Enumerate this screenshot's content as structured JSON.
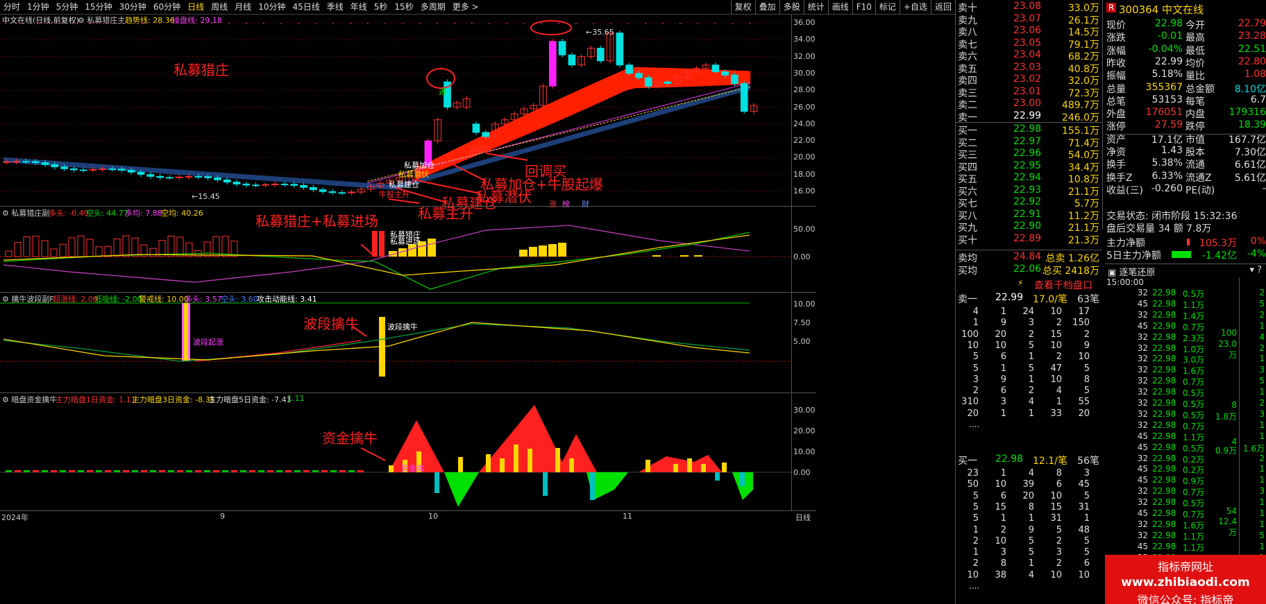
{
  "toolbar": {
    "tabs": [
      "分时",
      "1分钟",
      "5分钟",
      "15分钟",
      "30分钟",
      "60分钟",
      "日线",
      "周线",
      "月线",
      "10分钟",
      "45日线",
      "季线",
      "年线",
      "5秒",
      "15秒",
      "多周期",
      "更多 >"
    ],
    "active": "日线",
    "right": [
      "复权",
      "叠加",
      "多股",
      "统计",
      "画线",
      "F10",
      "标记",
      "+自选",
      "返回"
    ]
  },
  "main": {
    "title": "中文在线(日线,前复权)",
    "indicator": "私募猎庄主",
    "trend_label": "趋势线: 28.36",
    "control_label": "操盘线: 29.18",
    "y_ticks": [
      "36.00",
      "34.00",
      "32.00",
      "30.00",
      "28.00",
      "26.00",
      "24.00",
      "22.00",
      "20.00",
      "18.00",
      "16.00"
    ],
    "high_label": "35.65",
    "low_label": "15.45",
    "annotations": [
      "私募猎庄",
      "回调买",
      "私募加仓+牛股起爆",
      "私募潜伏",
      "私募建仓",
      "私募主升"
    ],
    "small_labels": [
      "私募加仓",
      "私募潜伏",
      "私募建仓",
      "牛股主升",
      "回调买",
      "进",
      "涨",
      "榜",
      "财"
    ]
  },
  "sub1": {
    "name": "私募猎庄副",
    "values": [
      "多头: -0.49",
      "空头: 44.77",
      "多均: 7.88",
      "空均: 40.26"
    ],
    "y_ticks": [
      "50.00",
      "0.00"
    ],
    "annotation": "私募猎庄+私募进场",
    "small": [
      "私募猎庄",
      "私募进场"
    ]
  },
  "sub2": {
    "name": "擒牛波段副F",
    "values": [
      "超涨线: 2.00",
      "低吸线: -2.00",
      "警戒线: 10.00",
      "多头: 3.57",
      "空头: 3.60",
      "攻击动能线: 3.41"
    ],
    "y_ticks": [
      "10.00",
      "7.50",
      "5.00"
    ],
    "annotation": "波段擒牛",
    "small": [
      "波段起涨",
      "波段擒牛"
    ]
  },
  "sub3": {
    "name": "暗盘资金擒牛",
    "values": [
      "主力暗盘1日资金: 1.11",
      "主力暗盘3日资金: -8.35",
      "主力暗盘5日资金: -7.41",
      "1.11"
    ],
    "y_ticks": [
      "30.00",
      "20.00",
      "10.00",
      "0.00"
    ],
    "annotation": "资金擒牛",
    "small": "资金擒"
  },
  "xaxis": {
    "labels": [
      "2024年",
      "9",
      "10",
      "11"
    ],
    "period": "日线"
  },
  "orderbook": {
    "asks": [
      {
        "label": "卖十",
        "price": "23.08",
        "vol": "33.0万"
      },
      {
        "label": "卖九",
        "price": "23.07",
        "vol": "26.1万"
      },
      {
        "label": "卖八",
        "price": "23.06",
        "vol": "14.5万"
      },
      {
        "label": "卖七",
        "price": "23.05",
        "vol": "79.1万"
      },
      {
        "label": "卖六",
        "price": "23.04",
        "vol": "68.2万"
      },
      {
        "label": "卖五",
        "price": "23.03",
        "vol": "40.8万"
      },
      {
        "label": "卖四",
        "price": "23.02",
        "vol": "32.0万"
      },
      {
        "label": "卖三",
        "price": "23.01",
        "vol": "72.3万"
      },
      {
        "label": "卖二",
        "price": "23.00",
        "vol": "489.7万"
      },
      {
        "label": "卖一",
        "price": "22.99",
        "vol": "246.0万"
      }
    ],
    "bids": [
      {
        "label": "买一",
        "price": "22.98",
        "vol": "155.1万"
      },
      {
        "label": "买二",
        "price": "22.97",
        "vol": "71.4万"
      },
      {
        "label": "买三",
        "price": "22.96",
        "vol": "54.0万"
      },
      {
        "label": "买四",
        "price": "22.95",
        "vol": "34.4万"
      },
      {
        "label": "买五",
        "price": "22.94",
        "vol": "10.8万"
      },
      {
        "label": "买六",
        "price": "22.93",
        "vol": "21.1万"
      },
      {
        "label": "买七",
        "price": "22.92",
        "vol": "5.7万"
      },
      {
        "label": "买八",
        "price": "22.91",
        "vol": "11.2万"
      },
      {
        "label": "买九",
        "price": "22.90",
        "vol": "21.1万"
      },
      {
        "label": "买十",
        "price": "22.89",
        "vol": "21.3万"
      }
    ],
    "sell_avg": {
      "label": "卖均",
      "price": "24.84",
      "tlabel": "总卖",
      "vol": "1.26亿"
    },
    "buy_avg": {
      "label": "买均",
      "price": "22.06",
      "tlabel": "总买",
      "vol": "2418万"
    },
    "ticket_btn": "查看千档盘口",
    "sell1_header": {
      "label": "卖一",
      "price": "22.99",
      "per": "17.0/笔",
      "count": "63笔"
    },
    "sell1_grid": [
      [
        "4",
        "1",
        "24",
        "10",
        "17"
      ],
      [
        "1",
        "9",
        "3",
        "2",
        "150"
      ],
      [
        "100",
        "20",
        "2",
        "15",
        "2"
      ],
      [
        "10",
        "10",
        "5",
        "10",
        "9"
      ],
      [
        "5",
        "6",
        "1",
        "2",
        "10"
      ],
      [
        "5",
        "1",
        "5",
        "47",
        "5"
      ],
      [
        "3",
        "9",
        "1",
        "10",
        "8"
      ],
      [
        "2",
        "6",
        "2",
        "4",
        "5"
      ],
      [
        "310",
        "3",
        "4",
        "1",
        "55"
      ],
      [
        "20",
        "1",
        "1",
        "33",
        "20"
      ]
    ],
    "buy1_header": {
      "label": "买一",
      "price": "22.98",
      "per": "12.1/笔",
      "count": "56笔"
    },
    "buy1_grid": [
      [
        "23",
        "1",
        "4",
        "8",
        "3"
      ],
      [
        "50",
        "10",
        "39",
        "6",
        "45"
      ],
      [
        "5",
        "6",
        "20",
        "10",
        "5"
      ],
      [
        "5",
        "15",
        "8",
        "15",
        "31"
      ],
      [
        "5",
        "1",
        "1",
        "31",
        "1"
      ],
      [
        "1",
        "2",
        "9",
        "5",
        "48"
      ],
      [
        "2",
        "10",
        "5",
        "2",
        "5"
      ],
      [
        "1",
        "3",
        "5",
        "3",
        "5"
      ],
      [
        "2",
        "8",
        "1",
        "2",
        "6"
      ],
      [
        "10",
        "38",
        "4",
        "10",
        "10"
      ]
    ],
    "more": "...."
  },
  "quote": {
    "code": "300364",
    "name": "中文在线",
    "badge": "R",
    "rows": [
      [
        "现价",
        "22.98",
        "今开",
        "22.79"
      ],
      [
        "涨跌",
        "-0.01",
        "最高",
        "23.28"
      ],
      [
        "涨幅",
        "-0.04%",
        "最低",
        "22.51"
      ],
      [
        "昨收",
        "22.99",
        "均价",
        "22.80"
      ],
      [
        "振幅",
        "5.18%",
        "量比",
        "1.08"
      ],
      [
        "总量",
        "355367",
        "总金额",
        "8.10亿"
      ],
      [
        "总笔",
        "53153",
        "每笔",
        "6.7"
      ],
      [
        "外盘",
        "176051",
        "内盘",
        "179316"
      ],
      [
        "涨停",
        "27.59",
        "跌停",
        "18.39"
      ],
      [
        "资产",
        "17.1亿",
        "市值",
        "167.7亿"
      ],
      [
        "净资",
        "1.43",
        "股本",
        "7.30亿"
      ],
      [
        "换手",
        "5.38%",
        "流通",
        "6.61亿"
      ],
      [
        "换手Z",
        "6.33%",
        "流通Z",
        "5.61亿"
      ],
      [
        "收益(三)",
        "-0.260",
        "PE(动)",
        "-"
      ]
    ],
    "status": "交易状态: 闭市阶段 15:32:36",
    "after_hours": "盘后交易量 34 额 7.8万",
    "main_net": {
      "label": "主力净额",
      "value": "105.3万",
      "pct": "0%"
    },
    "main_net5": {
      "label": "5日主力净额",
      "value": "-1.42亿",
      "pct": "-4%"
    }
  },
  "ticks": {
    "title": "逐笔还原",
    "time": "15:00:00",
    "rows": [
      [
        "22.98",
        "0.5万"
      ],
      [
        "22.98",
        "1.1万"
      ],
      [
        "22.98",
        "1.4万"
      ],
      [
        "22.98",
        "0.7万"
      ],
      [
        "22.98",
        "2.3万"
      ],
      [
        "22.98",
        "1.0万"
      ],
      [
        "22.98",
        "3.0万"
      ],
      [
        "22.98",
        "1.6万"
      ],
      [
        "22.98",
        "0.7万"
      ],
      [
        "22.98",
        "0.5万"
      ],
      [
        "22.98",
        "0.5万"
      ],
      [
        "22.98",
        "0.5万"
      ],
      [
        "22.98",
        "0.7万"
      ],
      [
        "22.98",
        "1.1万"
      ],
      [
        "22.98",
        "0.5万"
      ],
      [
        "22.98",
        "0.2万"
      ],
      [
        "22.98",
        "0.2万"
      ],
      [
        "22.98",
        "0.9万"
      ],
      [
        "22.98",
        "0.7万"
      ],
      [
        "22.98",
        "0.5万"
      ],
      [
        "22.98",
        "0.7万"
      ],
      [
        "22.98",
        "1.6万"
      ],
      [
        "22.98",
        "1.1万"
      ],
      [
        "22.98",
        "1.1万"
      ],
      [
        "22.98",
        "0.5万"
      ]
    ],
    "counts": [
      "32",
      "45",
      "32",
      "45",
      "32",
      "32",
      "32",
      "32",
      "32",
      "32",
      "32",
      "32",
      "32",
      "45",
      "45",
      "32",
      "45",
      "45",
      "32",
      "32",
      "45",
      "32",
      "32",
      "45",
      "32"
    ],
    "mid_labels": [
      "100",
      "23.0万",
      "8",
      "1.8万",
      "4",
      "0.9万",
      "54",
      "12.4万"
    ],
    "right_col": [
      "2",
      "5",
      "2",
      "1",
      "4",
      "2",
      "1",
      "3",
      "5",
      "1",
      "2",
      "3",
      "1",
      "1",
      "1.6万",
      "2",
      "1",
      "1",
      "3",
      "1",
      "1",
      "1",
      "5",
      "1",
      "1"
    ]
  },
  "banner": {
    "line1": "指标帝网址",
    "line2": "www.zhibiaodi.com",
    "line3": "微信公众号: 指标帝"
  },
  "colors": {
    "up": "#ff3030",
    "down": "#00e0e0",
    "ribbon": "#ff2000",
    "blue_ribbon": "#2050a0",
    "yellow": "#ffd700",
    "green": "#00e000"
  }
}
